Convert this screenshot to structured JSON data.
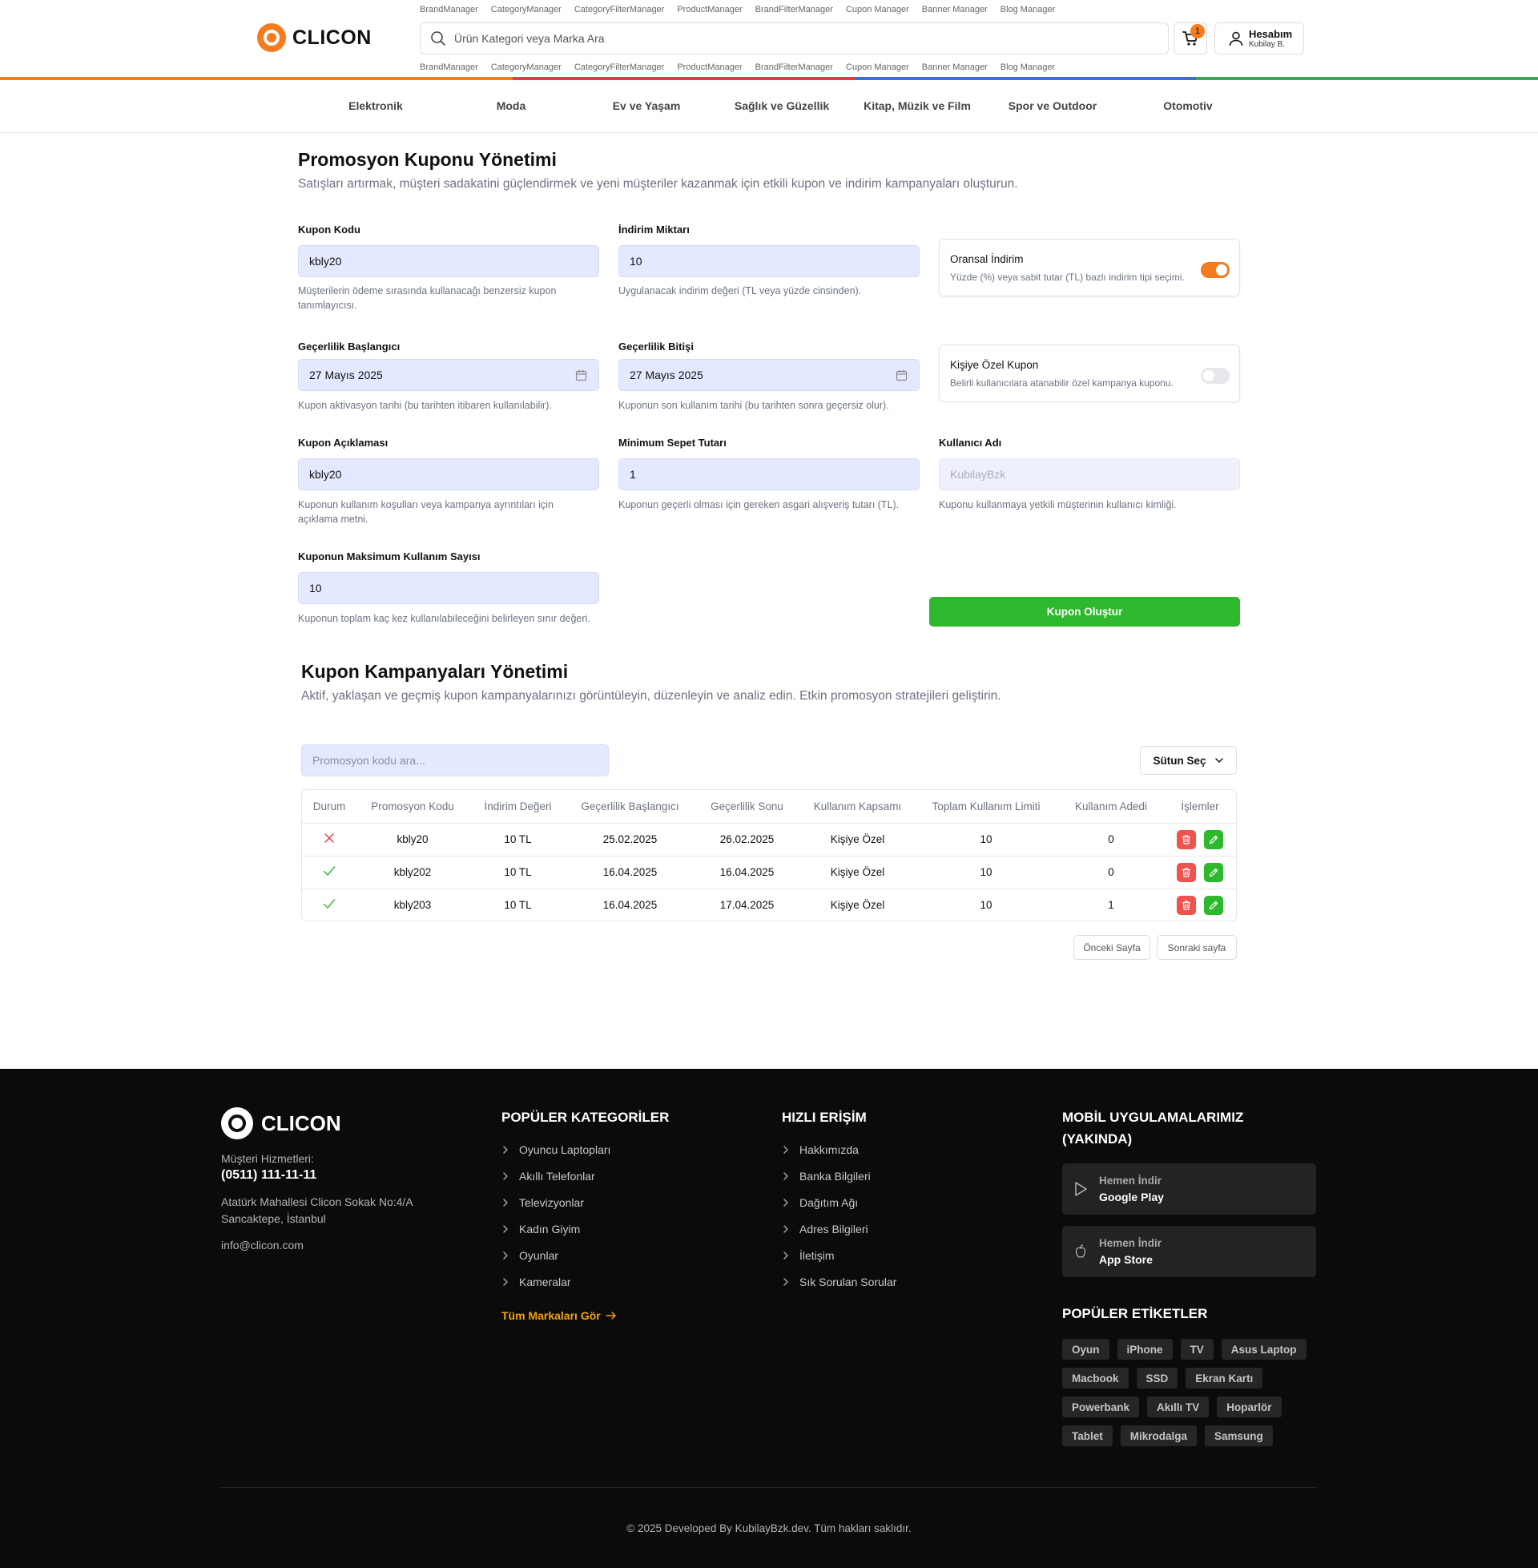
{
  "header": {
    "logo_text": "CLICON",
    "quick_links": [
      "BrandManager",
      "CategoryManager",
      "CategoryFilterManager",
      "ProductManager",
      "BrandFilterManager",
      "Cupon Manager",
      "Banner Manager",
      "Blog Manager"
    ],
    "search_placeholder": "Ürün Kategori veya Marka Ara",
    "cart_count": "1",
    "account_title": "Hesabım",
    "account_user": "Kubilay B.",
    "bar_colors": [
      "#f47b20",
      "#e53945",
      "#3b6fd6",
      "#34a853"
    ]
  },
  "categories": [
    "Elektronik",
    "Moda",
    "Ev ve Yaşam",
    "Sağlık ve Güzellik",
    "Kitap, Müzik ve Film",
    "Spor ve Outdoor",
    "Otomotiv"
  ],
  "form": {
    "title": "Promosyon Kuponu Yönetimi",
    "subtitle": "Satışları artırmak, müşteri sadakatini güçlendirmek ve yeni müşteriler kazanmak için etkili kupon ve indirim kampanyaları oluşturun.",
    "coupon_code": {
      "label": "Kupon Kodu",
      "value": "kbly20",
      "help": "Müşterilerin ödeme sırasında kullanacağı benzersiz kupon tanımlayıcısı."
    },
    "discount": {
      "label": "İndirim Miktarı",
      "value": "10",
      "help": "Uygulanacak indirim değeri (TL veya yüzde cinsinden)."
    },
    "percent_toggle": {
      "title": "Oransal İndirim",
      "desc": "Yüzde (%) veya sabit tutar (TL) bazlı indirim tipi seçimi.",
      "on": true
    },
    "start_date": {
      "label": "Geçerlilik Başlangıcı",
      "value": "27 Mayıs 2025",
      "help": "Kupon aktivasyon tarihi (bu tarihten itibaren kullanılabilir)."
    },
    "end_date": {
      "label": "Geçerlilik Bitişi",
      "value": "27 Mayıs 2025",
      "help": "Kuponun son kullanım tarihi (bu tarihten sonra geçersiz olur)."
    },
    "personal_toggle": {
      "title": "Kişiye Özel Kupon",
      "desc": "Belirli kullanıcılara atanabilir özel kampanya kuponu.",
      "on": false
    },
    "description": {
      "label": "Kupon Açıklaması",
      "value": "kbly20",
      "help": "Kuponun kullanım koşulları veya kampanya ayrıntıları için açıklama metni."
    },
    "min_cart": {
      "label": "Minimum Sepet Tutarı",
      "value": "1",
      "help": "Kuponun geçerli olması için gereken asgari alışveriş tutarı (TL)."
    },
    "username": {
      "label": "Kullanıcı Adı",
      "placeholder": "KubilayBzk",
      "help": "Kuponu kullanmaya yetkili müşterinin kullanıcı kimliği."
    },
    "max_usage": {
      "label": "Kuponun Maksimum Kullanım Sayısı",
      "value": "10",
      "help": "Kuponun toplam kaç kez kullanılabileceğini belirleyen sınır değeri."
    },
    "submit_label": "Kupon Oluştur"
  },
  "campaigns": {
    "title": "Kupon Kampanyaları Yönetimi",
    "subtitle": "Aktif, yaklaşan ve geçmiş kupon kampanyalarınızı görüntüleyin, düzenleyin ve analiz edin. Etkin promosyon stratejileri geliştirin.",
    "search_placeholder": "Promosyon kodu ara...",
    "column_select_label": "Sütun Seç",
    "columns": [
      "Durum",
      "Promosyon Kodu",
      "İndirim Değeri",
      "Geçerlilik Başlangıcı",
      "Geçerlilik Sonu",
      "Kullanım Kapsamı",
      "Toplam Kullanım Limiti",
      "Kullanım Adedi",
      "İşlemler"
    ],
    "rows": [
      {
        "status": "inactive",
        "code": "kbly20",
        "discount": "10 TL",
        "start": "25.02.2025",
        "end": "26.02.2025",
        "scope": "Kişiye Özel",
        "limit": "10",
        "used": "0"
      },
      {
        "status": "active",
        "code": "kbly202",
        "discount": "10 TL",
        "start": "16.04.2025",
        "end": "16.04.2025",
        "scope": "Kişiye Özel",
        "limit": "10",
        "used": "0"
      },
      {
        "status": "active",
        "code": "kbly203",
        "discount": "10 TL",
        "start": "16.04.2025",
        "end": "17.04.2025",
        "scope": "Kişiye Özel",
        "limit": "10",
        "used": "1"
      }
    ],
    "prev_label": "Önceki Sayfa",
    "next_label": "Sonraki sayfa",
    "status_colors": {
      "active": "#2eb82e",
      "inactive": "#e53945"
    }
  },
  "footer": {
    "logo_text": "CLICON",
    "support_label": "Müşteri Hizmetleri:",
    "phone": "(0511) 111-11-11",
    "address_1": "Atatürk Mahallesi Clicon Sokak No:4/A",
    "address_2": "Sancaktepe, İstanbul",
    "email": "info@clicon.com",
    "popular_categories_title": "POPÜLER KATEGORİLER",
    "popular_categories": [
      "Oyuncu Laptopları",
      "Akıllı Telefonlar",
      "Televizyonlar",
      "Kadın Giyim",
      "Oyunlar",
      "Kameralar"
    ],
    "all_brands_label": "Tüm Markaları Gör",
    "quick_access_title": "HIZLI ERİŞİM",
    "quick_access": [
      "Hakkımızda",
      "Banka Bilgileri",
      "Dağıtım Ağı",
      "Adres Bilgileri",
      "İletişim",
      "Sık Sorulan Sorular"
    ],
    "mobile_title_1": "MOBİL UYGULAMALARIMIZ",
    "mobile_title_2": "(YAKINDA)",
    "google_play": {
      "line1": "Hemen İndir",
      "line2": "Google Play"
    },
    "app_store": {
      "line1": "Hemen İndir",
      "line2": "App Store"
    },
    "tags_title": "POPÜLER ETİKETLER",
    "tags": [
      [
        "Oyun",
        "iPhone",
        "TV",
        "Asus Laptop"
      ],
      [
        "Macbook",
        "SSD",
        "Ekran Kartı"
      ],
      [
        "Powerbank",
        "Akıllı TV",
        "Hoparlör"
      ],
      [
        "Tablet",
        "Mikrodalga",
        "Samsung"
      ]
    ],
    "copyright": "© 2025 Developed By KubilayBzk.dev. Tüm hakları saklıdır."
  }
}
